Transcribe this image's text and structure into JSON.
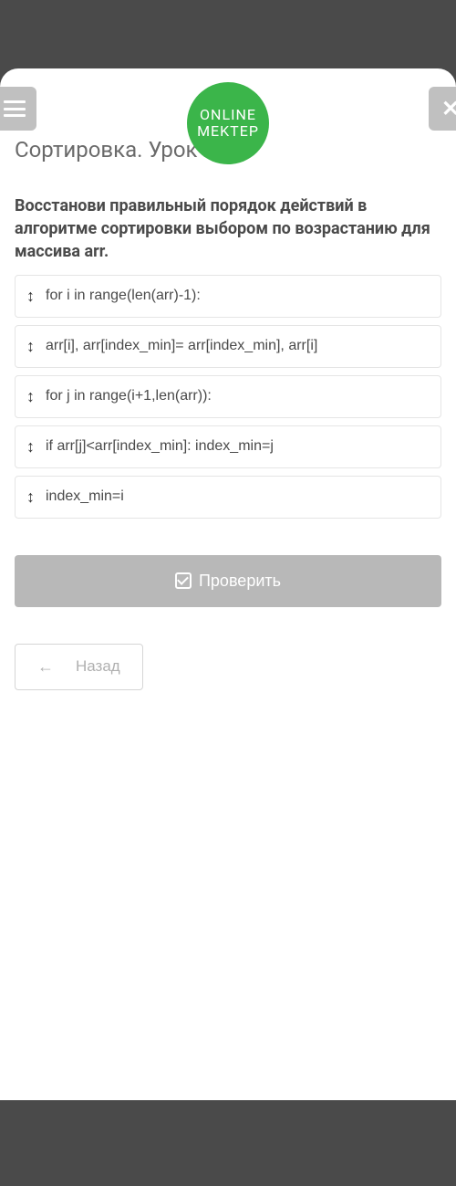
{
  "logo": {
    "line1": "ONLINE",
    "line2": "MEKTEP"
  },
  "title": "Сортировка. Урок 2",
  "question": "Восстанови правильный порядок действий в алгоритме сортировки выбором по возрастанию для массива arr.",
  "items": [
    {
      "text": "for i in range(len(arr)-1):"
    },
    {
      "text": "arr[i], arr[index_min]= arr[index_min], arr[i]"
    },
    {
      "text": "for j in range(i+1,len(arr)):"
    },
    {
      "text": "if arr[j]<arr[index_min]: index_min=j"
    },
    {
      "text": "index_min=i"
    }
  ],
  "buttons": {
    "check": "Проверить",
    "back": "Назад"
  }
}
